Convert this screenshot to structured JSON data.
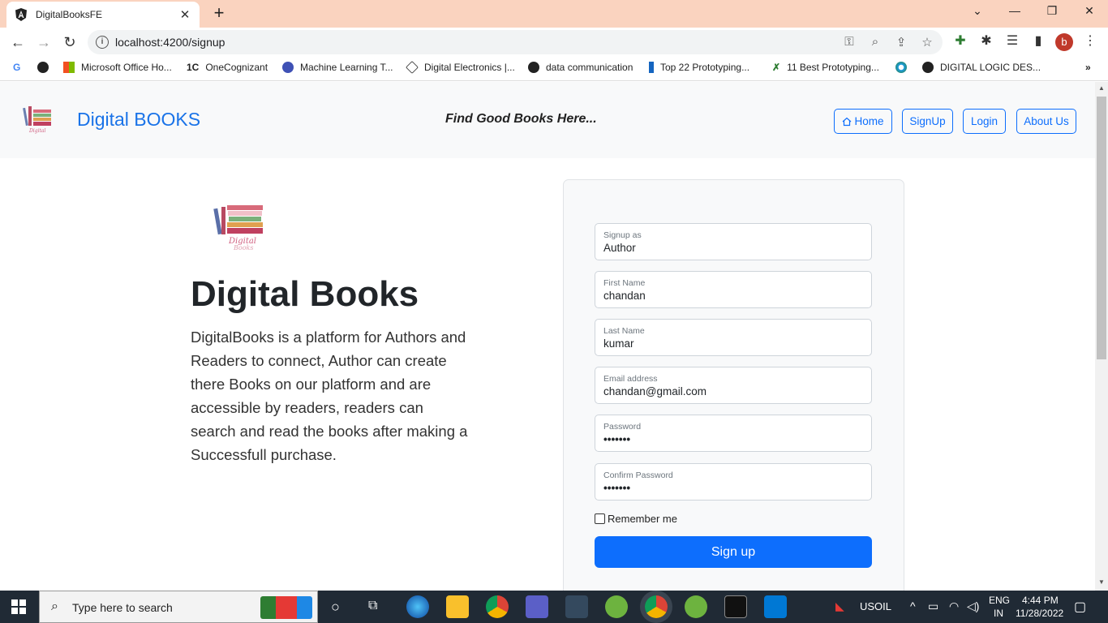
{
  "browser": {
    "tab_title": "DigitalBooksFE",
    "url": "localhost:4200/signup",
    "bookmarks": [
      "Microsoft Office Ho...",
      "OneCognizant",
      "Machine Learning T...",
      "Digital Electronics |...",
      "data communication",
      "Top 22 Prototyping...",
      "11 Best Prototyping...",
      "DIGITAL LOGIC DES..."
    ],
    "profile_letter": "b"
  },
  "header": {
    "brand": "Digital BOOKS",
    "tagline": "Find Good Books Here...",
    "nav": [
      "Home",
      "SignUp",
      "Login",
      "About Us"
    ]
  },
  "hero": {
    "title": "Digital Books",
    "description": "DigitalBooks is a platform for Authors and Readers to connect, Author can create there Books on our platform and are accessible by readers, readers can search and read the books after making a Successfull purchase."
  },
  "form": {
    "fields": [
      {
        "label": "Signup as",
        "value": "Author"
      },
      {
        "label": "First Name",
        "value": "chandan"
      },
      {
        "label": "Last Name",
        "value": "kumar"
      },
      {
        "label": "Email address",
        "value": "chandan@gmail.com"
      },
      {
        "label": "Password",
        "value": "•••••••"
      },
      {
        "label": "Confirm Password",
        "value": "•••••••"
      }
    ],
    "remember_label": "Remember me",
    "submit_label": "Sign up"
  },
  "taskbar": {
    "search_placeholder": "Type here to search",
    "weather": "USOIL",
    "lang_top": "ENG",
    "lang_bottom": "IN",
    "time": "4:44 PM",
    "date": "11/28/2022"
  },
  "colors": {
    "primary": "#0d6efd",
    "brand": "#1a73e8",
    "tabbar": "#fad3bf"
  }
}
